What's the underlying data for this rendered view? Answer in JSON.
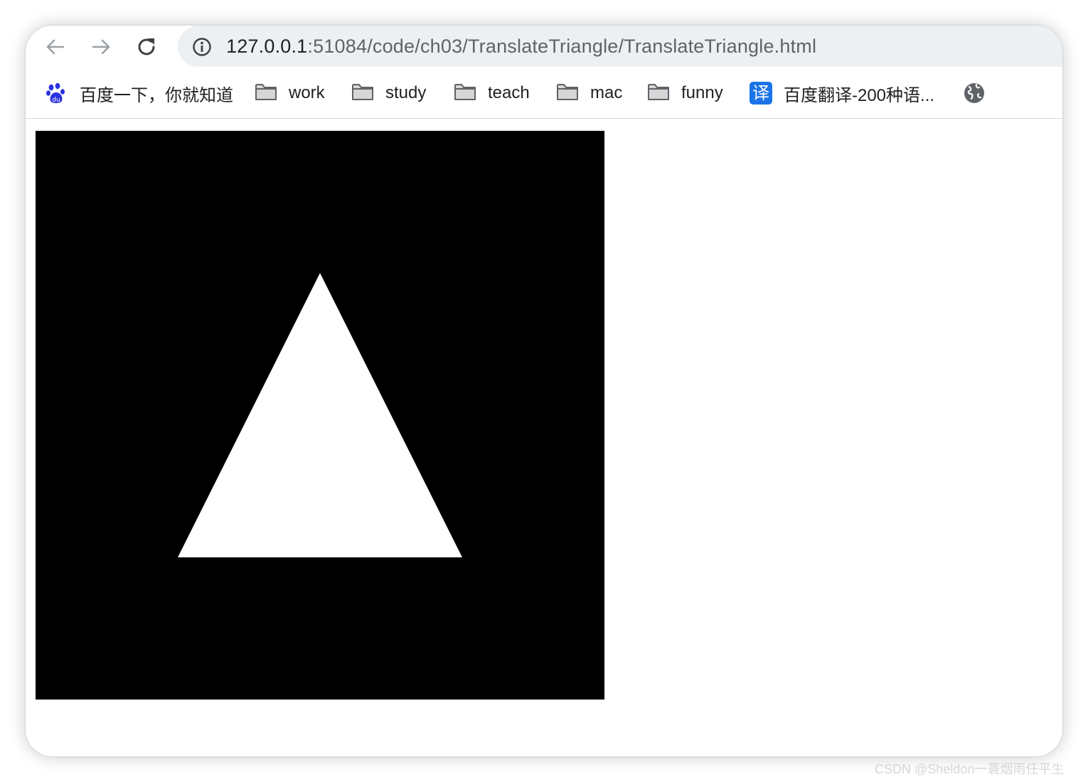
{
  "browser": {
    "url_host": "127.0.0.1",
    "url_path": ":51084/code/ch03/TranslateTriangle/TranslateTriangle.html",
    "back_icon": "arrow-left",
    "forward_icon": "arrow-right",
    "reload_icon": "reload",
    "info_icon": "info-circle"
  },
  "bookmarks": [
    {
      "label": "百度一下，你就知道",
      "icon": "baidu-paw-icon"
    },
    {
      "label": "work",
      "icon": "folder-icon"
    },
    {
      "label": "study",
      "icon": "folder-icon"
    },
    {
      "label": "teach",
      "icon": "folder-icon"
    },
    {
      "label": "mac",
      "icon": "folder-icon"
    },
    {
      "label": "funny",
      "icon": "folder-icon"
    },
    {
      "label": "百度翻译-200种语...",
      "icon": "translate-icon",
      "icon_glyph": "译"
    },
    {
      "label": "",
      "icon": "globe-icon"
    }
  ],
  "canvas": {
    "background": "#000000",
    "shape": "triangle",
    "fill": "#ffffff"
  },
  "watermark": "CSDN @Sheldon一蓑烟雨任平生",
  "colors": {
    "accent": "#1a73e8",
    "baidu": "#2932e1",
    "omnibox": "#edf0f2"
  }
}
